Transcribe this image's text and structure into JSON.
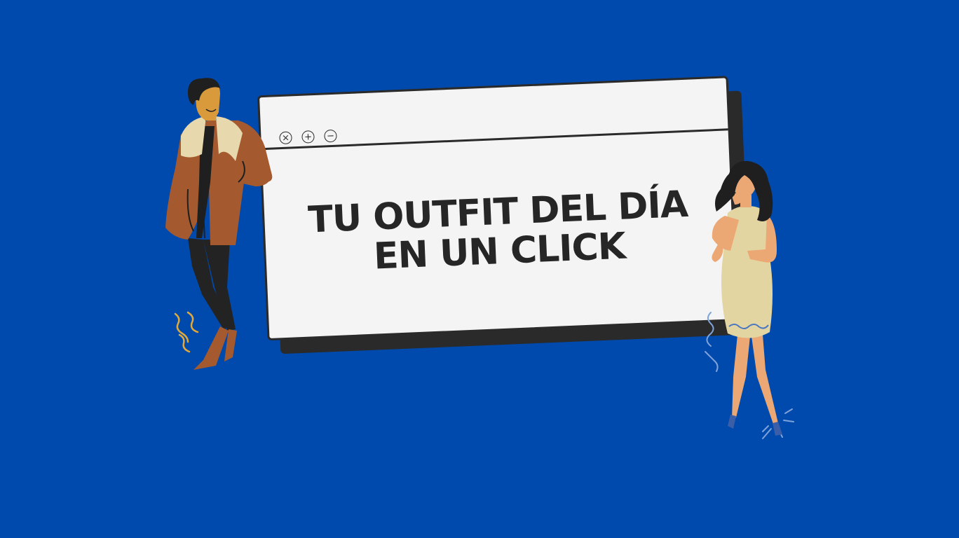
{
  "colors": {
    "background": "#004AAD",
    "window_fill": "#F4F4F4",
    "outline": "#2A2A2A",
    "coat": "#A45A2E",
    "collar": "#E7D8AE",
    "skin_man": "#D99A3C",
    "skin_woman": "#EBA874",
    "dress": "#E3D5A2",
    "hair": "#1F1F1F"
  },
  "window": {
    "controls": [
      {
        "name": "close-control",
        "glyph": "×"
      },
      {
        "name": "maximize-control",
        "glyph": "+"
      },
      {
        "name": "minimize-control",
        "glyph": "−"
      }
    ],
    "headline_line1": "TU OUTFIT DEL DÍA",
    "headline_line2": "EN UN CLICK"
  },
  "illustrations": {
    "left": "man-in-coat-illustration",
    "right": "woman-in-dress-illustration"
  }
}
